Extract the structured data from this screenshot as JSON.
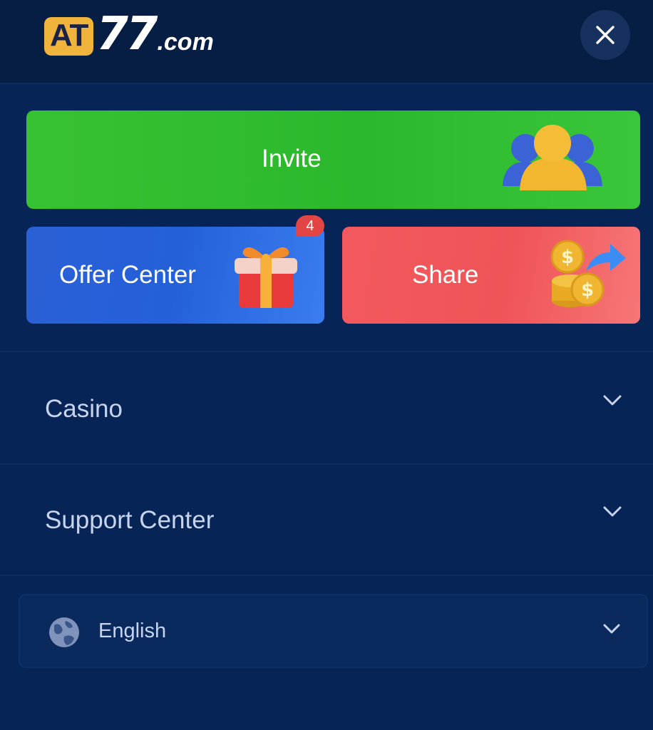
{
  "header": {
    "logo": {
      "brand": "AT",
      "number": "77",
      "domain": ".com"
    },
    "close_icon": "close-icon"
  },
  "cards": {
    "invite": {
      "label": "Invite",
      "icon": "people-icon",
      "color": "#2fbb2f"
    },
    "offer": {
      "label": "Offer Center",
      "icon": "gift-box-icon",
      "badge": "4",
      "color": "#2a62d8"
    },
    "share": {
      "label": "Share",
      "icon": "coins-arrow-icon",
      "color": "#f0595c"
    }
  },
  "menu": {
    "items": [
      {
        "label": "Casino",
        "icon": "chevron-down-icon"
      },
      {
        "label": "Support Center",
        "icon": "chevron-down-icon"
      }
    ]
  },
  "language": {
    "label": "English",
    "icon": "globe-icon",
    "chevron": "chevron-down-icon"
  },
  "colors": {
    "background": "#062455",
    "header": "#061d44",
    "accent_gold": "#f0b33b",
    "badge": "#e34545"
  }
}
